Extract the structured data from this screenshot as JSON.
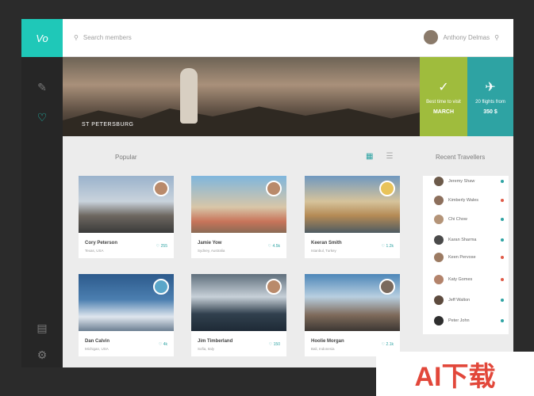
{
  "app": {
    "logo_text": "Vo"
  },
  "topbar": {
    "search_placeholder": "Search members",
    "user_name": "Anthony Delmas"
  },
  "hero": {
    "label": "ST PETERSBURG"
  },
  "tiles": [
    {
      "title": "Best time to visit",
      "value": "MARCH",
      "icon": "check-icon",
      "bg": "#9fbc3d"
    },
    {
      "title": "20 flights from",
      "value": "350 $",
      "icon": "plane-icon",
      "bg": "#2ea3a3"
    }
  ],
  "section": {
    "title": "Popular",
    "right_title": "Recent Travellers"
  },
  "cards": [
    {
      "name": "Cory Peterson",
      "location": "Texas, USA",
      "likes": "255"
    },
    {
      "name": "Jamie Yow",
      "location": "Sydney, Australia",
      "likes": "4.5k"
    },
    {
      "name": "Keeran Smith",
      "location": "Istanbul, Turkey",
      "likes": "1.2k"
    },
    {
      "name": "Dan Calvin",
      "location": "Michigan, USA",
      "likes": "4k"
    },
    {
      "name": "Jim Timberland",
      "location": "Sofia, Italy",
      "likes": "150"
    },
    {
      "name": "Hoolie Morgan",
      "location": "Bali, Indonesia",
      "likes": "2.1k"
    }
  ],
  "travellers": [
    {
      "name": "Jeremy Shaw",
      "dot": "#2ea3a3"
    },
    {
      "name": "Kimberly Wales",
      "dot": "#e05a47"
    },
    {
      "name": "Chi Chow",
      "dot": "#2ea3a3"
    },
    {
      "name": "Karan Sharma",
      "dot": "#2ea3a3"
    },
    {
      "name": "Keen Pervose",
      "dot": "#e05a47"
    },
    {
      "name": "Katy Gomes",
      "dot": "#e05a47"
    },
    {
      "name": "Jeff Walton",
      "dot": "#2ea3a3"
    },
    {
      "name": "Peter John",
      "dot": "#2ea3a3"
    }
  ],
  "watermark": "AI下载"
}
